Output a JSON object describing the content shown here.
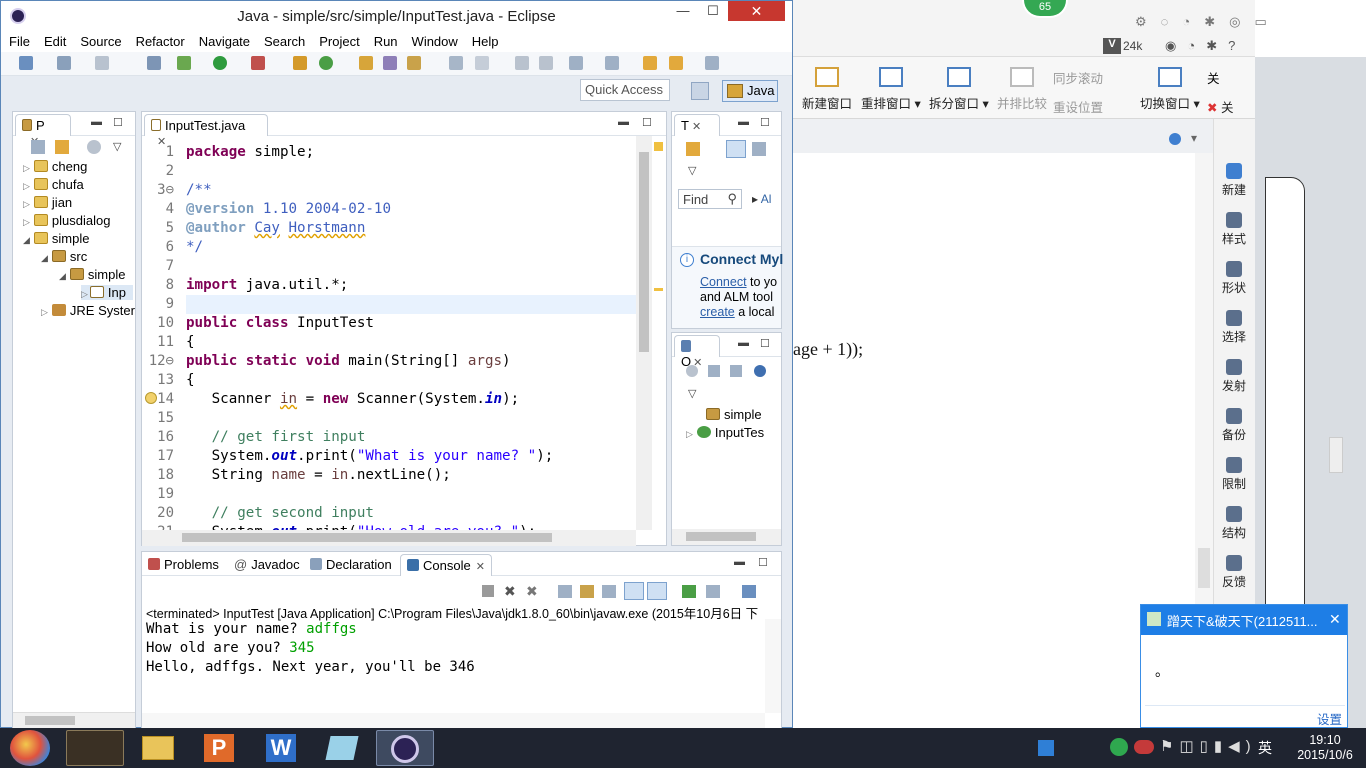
{
  "window": {
    "title": "Java - simple/src/simple/InputTest.java - Eclipse",
    "close": "✕",
    "minimize": "—",
    "maximize": "☐"
  },
  "menu": [
    "File",
    "Edit",
    "Source",
    "Refactor",
    "Navigate",
    "Search",
    "Project",
    "Run",
    "Window",
    "Help"
  ],
  "quick_access": "Quick Access",
  "perspective": "Java",
  "package_explorer": {
    "tab": "P",
    "items": [
      {
        "label": "cheng",
        "level": 1,
        "expand": "▷"
      },
      {
        "label": "chufa",
        "level": 1,
        "expand": "▷"
      },
      {
        "label": "jian",
        "level": 1,
        "expand": "▷"
      },
      {
        "label": "plusdialog",
        "level": 1,
        "expand": "▷"
      },
      {
        "label": "simple",
        "level": 1,
        "expand": "◢"
      },
      {
        "label": "src",
        "level": 2,
        "expand": "◢"
      },
      {
        "label": "simple",
        "level": 3,
        "expand": "◢"
      },
      {
        "label": "Inp",
        "level": 4,
        "expand": "▷"
      },
      {
        "label": "JRE Syster",
        "level": 2,
        "expand": "▷"
      }
    ]
  },
  "editor": {
    "tab": "InputTest.java",
    "lines": [
      {
        "n": "1",
        "html": "<span class='kw'>package</span> simple;"
      },
      {
        "n": "2",
        "html": ""
      },
      {
        "n": "3⊖",
        "html": "<span class='dc'>/**</span>"
      },
      {
        "n": "4",
        "html": "<span class='an'>@version</span><span class='dc'> 1.10 2004-02-10</span>"
      },
      {
        "n": "5",
        "html": "<span class='an'>@author</span><span class='dc'> <span class='sq'>Cay</span> <span class='sq'>Horstmann</span></span>"
      },
      {
        "n": "6",
        "html": "<span class='dc'>*/</span>"
      },
      {
        "n": "7",
        "html": ""
      },
      {
        "n": "8",
        "html": "<span class='kw'>import</span> java.util.*;"
      },
      {
        "n": "9",
        "html": ""
      },
      {
        "n": "10",
        "html": "<span class='kw'>public class</span> InputTest"
      },
      {
        "n": "11",
        "html": "{"
      },
      {
        "n": "12⊖",
        "html": "<span class='kw'>public static void</span> main(String[] <span class='var'>args</span>)"
      },
      {
        "n": "13",
        "html": "{"
      },
      {
        "n": "14",
        "html": "   Scanner <span class='var sq'>in</span> = <span class='kw'>new</span> Scanner(System.<span class='fld'>in</span>);"
      },
      {
        "n": "15",
        "html": ""
      },
      {
        "n": "16",
        "html": "   <span class='cm'>// get first input</span>"
      },
      {
        "n": "17",
        "html": "   System.<span class='fld'>out</span>.print(<span class='st'>\"What is your name? \"</span>);"
      },
      {
        "n": "18",
        "html": "   String <span class='var'>name</span> = <span class='var'>in</span>.nextLine();"
      },
      {
        "n": "19",
        "html": ""
      },
      {
        "n": "20",
        "html": "   <span class='cm'>// get second input</span>"
      },
      {
        "n": "21",
        "html": "   System.<span class='fld'>out</span>.print(<span class='st'>\"How old are you? \"</span>);"
      }
    ]
  },
  "task_list": {
    "tab": "T",
    "find_placeholder": "Find",
    "all": "Al",
    "connect_title": "Connect Myl",
    "connect_link": "Connect",
    "connect_text1": " to yo",
    "connect_text2": "and ALM tool",
    "create_link": "create",
    "create_text": " a local"
  },
  "outline": {
    "tab": "O",
    "items": [
      "simple",
      "InputTes"
    ]
  },
  "bottom_tabs": [
    "Problems",
    "Javadoc",
    "Declaration",
    "Console"
  ],
  "console": {
    "header": "<terminated> InputTest [Java Application] C:\\Program Files\\Java\\jdk1.8.0_60\\bin\\javaw.exe (2015年10月6日 下",
    "lines": [
      {
        "prompt": "What is your name? ",
        "input": "adffgs"
      },
      {
        "prompt": "How old are you? ",
        "input": "345"
      },
      {
        "prompt": "Hello, adffgs. Next year, you'll be 346",
        "input": ""
      }
    ]
  },
  "right_app": {
    "badge": "65",
    "speed": "24k",
    "ribbon": [
      "新建窗口",
      "重排窗口",
      "拆分窗口",
      "并排比较",
      "重设位置",
      "切换窗口",
      "关"
    ],
    "sync_label": "同步滚动",
    "doc_text": "age + 1));",
    "side": [
      "新建",
      "样式",
      "形状",
      "选择",
      "发射",
      "备份",
      "限制",
      "结构",
      "反馈"
    ],
    "chat_title": "蹭天下&破天下(2112511...",
    "chat_body": "。",
    "chat_settings": "设置"
  },
  "taskbar": {
    "time": "19:10",
    "date": "2015/10/6",
    "ime": "英"
  }
}
